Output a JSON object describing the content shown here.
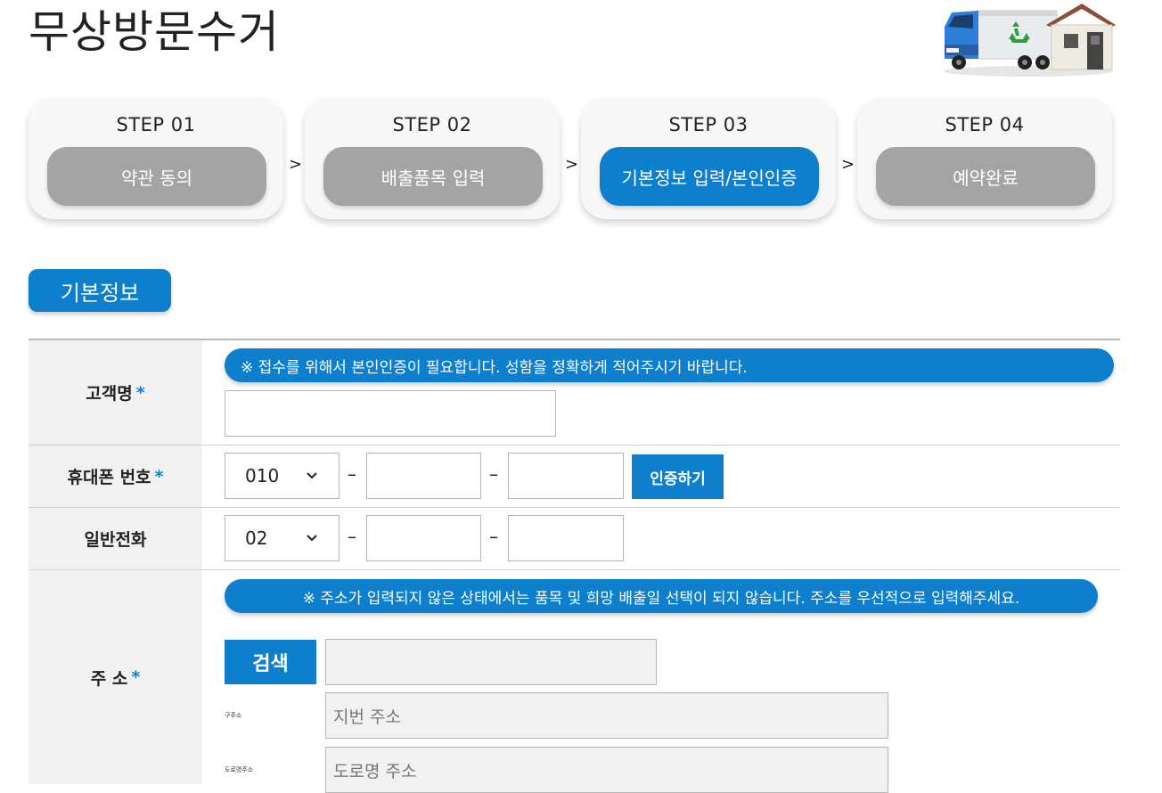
{
  "page": {
    "title": "무상방문수거"
  },
  "steps": [
    {
      "num": "STEP 01",
      "label": "약관 동의",
      "active": false
    },
    {
      "num": "STEP 02",
      "label": "배출품목 입력",
      "active": false
    },
    {
      "num": "STEP 03",
      "label": "기본정보 입력/본인인증",
      "active": true
    },
    {
      "num": "STEP 04",
      "label": "예약완료",
      "active": false
    }
  ],
  "step_separator": ">",
  "section": {
    "title": "기본정보"
  },
  "form": {
    "name": {
      "label": "고객명",
      "required_mark": "*",
      "notice": "※ 접수를 위해서 본인인증이 필요합니다. 성함을 정확하게 적어주시기 바랍니다.",
      "value": ""
    },
    "mobile": {
      "label": "휴대폰 번호",
      "required_mark": "*",
      "prefix": "010",
      "dash": "–",
      "verify_label": "인증하기"
    },
    "phone": {
      "label": "일반전화",
      "prefix": "02",
      "dash": "–"
    },
    "address": {
      "label": "주 소",
      "required_mark": "*",
      "notice": "※ 주소가 입력되지 않은 상태에서는 품목 및 희망 배출일 선택이 되지 않습니다. 주소를 우선적으로 입력해주세요.",
      "search_label": "검색",
      "jibun_tag": "구주소",
      "jibun_placeholder": "지번 주소",
      "road_tag": "도로명주소",
      "road_placeholder": "도로명 주소"
    }
  },
  "colors": {
    "accent": "#0d7fcd",
    "inactive": "#a4a4a4",
    "label_bg": "#f1f1f1"
  }
}
